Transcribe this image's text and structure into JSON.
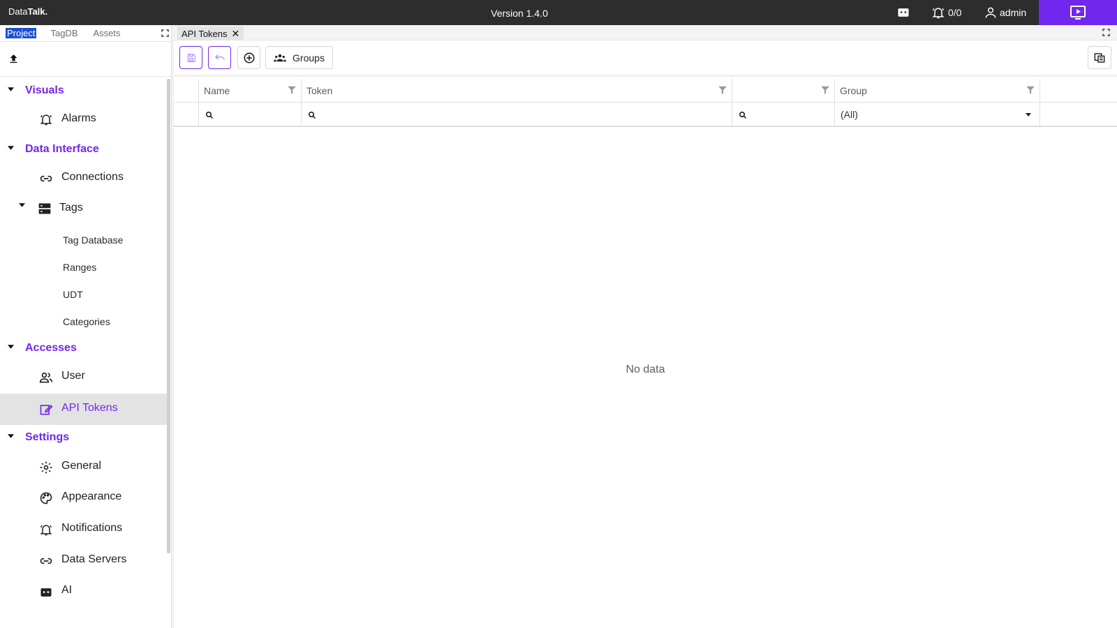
{
  "topbar": {
    "brand_light": "Data",
    "brand_bold": "Talk.",
    "version": "Version 1.4.0",
    "alarm_count": "0/0",
    "user": "admin",
    "accent_color": "#7127ed"
  },
  "left_panel": {
    "tabs": [
      "Project",
      "TagDB",
      "Assets"
    ],
    "active_tab": "Project"
  },
  "tree": {
    "visuals": "Visuals",
    "alarms": "Alarms",
    "data_interface": "Data Interface",
    "connections": "Connections",
    "tags": "Tags",
    "tag_database": "Tag Database",
    "ranges": "Ranges",
    "udt": "UDT",
    "categories": "Categories",
    "accesses": "Accesses",
    "user": "User",
    "api_tokens": "API Tokens",
    "settings": "Settings",
    "general": "General",
    "appearance": "Appearance",
    "notifications": "Notifications",
    "data_servers": "Data Servers",
    "ai": "AI"
  },
  "document": {
    "tab_label": "API Tokens"
  },
  "toolbar": {
    "groups_label": "Groups"
  },
  "grid": {
    "columns": [
      "Name",
      "Token",
      "",
      "Group"
    ],
    "group_filter_value": "(All)",
    "empty_text": "No data"
  }
}
